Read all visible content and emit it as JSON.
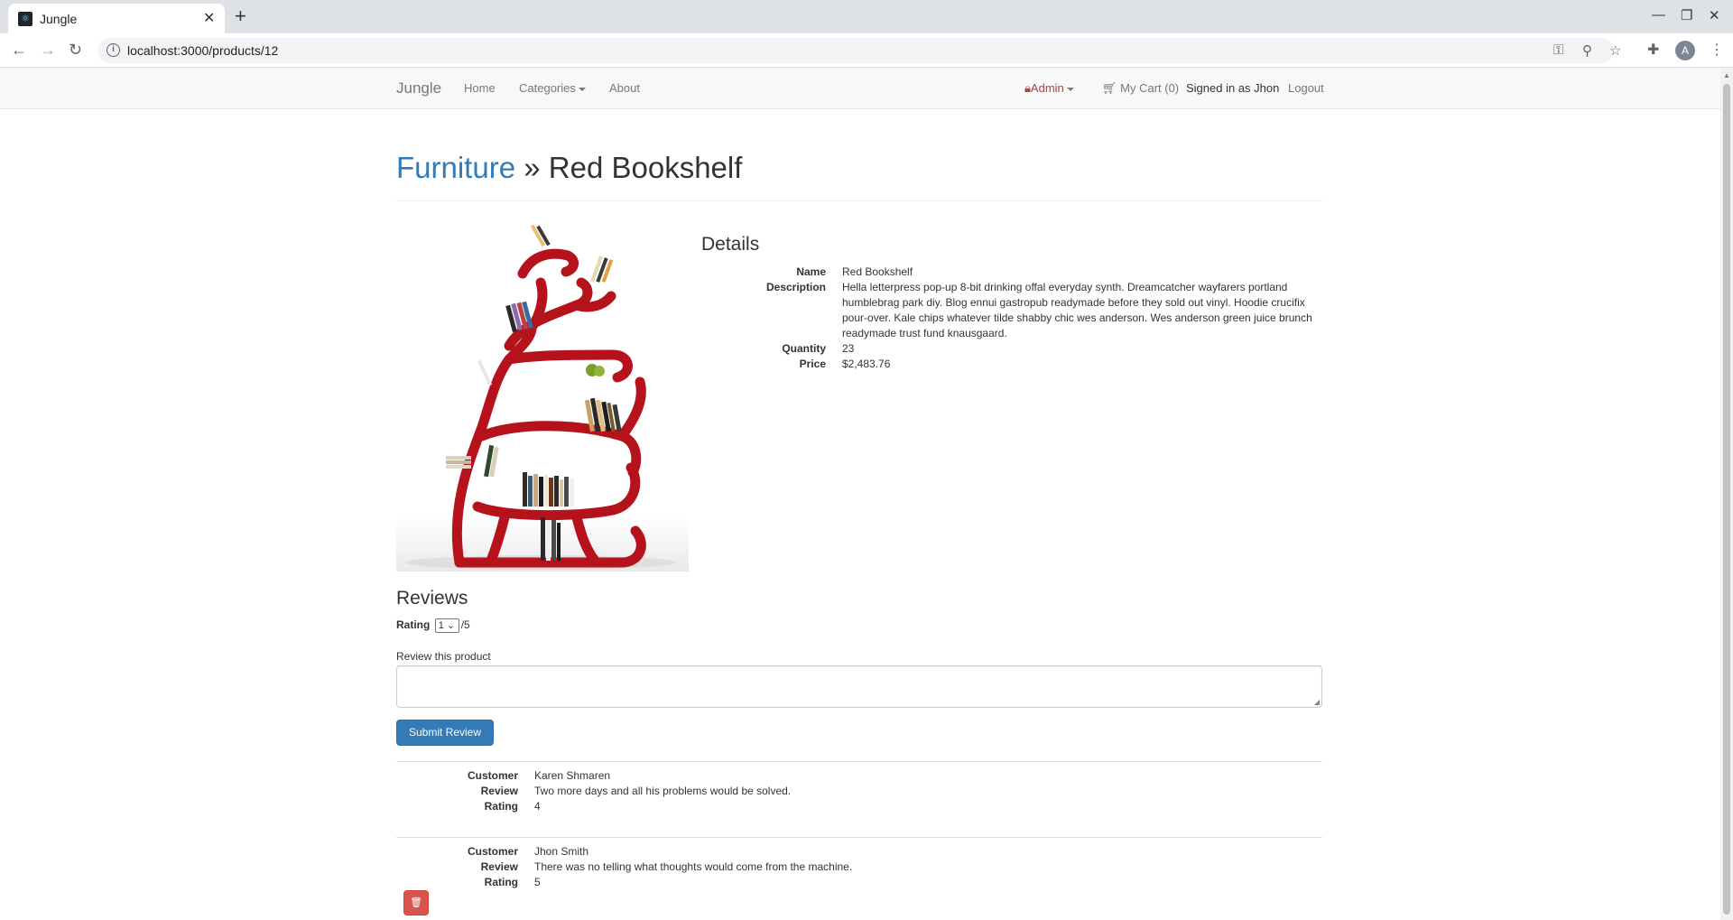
{
  "browser": {
    "tab_title": "Jungle",
    "url": "localhost:3000/products/12",
    "profile_initial": "A"
  },
  "navbar": {
    "brand": "Jungle",
    "home": "Home",
    "categories": "Categories",
    "about": "About",
    "admin": "Admin",
    "cart": "My Cart (0)",
    "signed_in": "Signed in as Jhon",
    "logout": "Logout"
  },
  "header": {
    "category": "Furniture",
    "separator": " » ",
    "product": "Red Bookshelf"
  },
  "details": {
    "title": "Details",
    "name_label": "Name",
    "name": "Red Bookshelf",
    "description_label": "Description",
    "description": "Hella letterpress pop-up 8-bit drinking offal everyday synth. Dreamcatcher wayfarers portland humblebrag park diy. Blog ennui gastropub readymade before they sold out vinyl. Hoodie crucifix pour-over. Kale chips whatever tilde shabby chic wes anderson. Wes anderson green juice brunch readymade trust fund knausgaard.",
    "quantity_label": "Quantity",
    "quantity": "23",
    "price_label": "Price",
    "price": "$2,483.76"
  },
  "review_form": {
    "title": "Reviews",
    "rating_label": "Rating",
    "rating_value": "1",
    "rating_max": "/5",
    "review_label": "Review this product",
    "review_value": "",
    "submit": "Submit Review"
  },
  "reviews": [
    {
      "customer_label": "Customer",
      "customer": "Karen Shmaren",
      "review_label": "Review",
      "review": "Two more days and all his problems would be solved.",
      "rating_label": "Rating",
      "rating": "4",
      "deletable": false
    },
    {
      "customer_label": "Customer",
      "customer": "Jhon Smith",
      "review_label": "Review",
      "review": "There was no telling what thoughts would come from the machine.",
      "rating_label": "Rating",
      "rating": "5",
      "deletable": true
    }
  ],
  "colors": {
    "link": "#337ab7",
    "primary_button": "#337ab7",
    "danger_button": "#d9534f",
    "admin": "#a94442",
    "shelf_red": "#b5121b"
  }
}
